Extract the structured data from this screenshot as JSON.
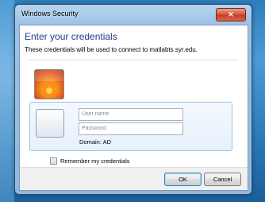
{
  "window": {
    "title": "Windows Security",
    "close_glyph": "×"
  },
  "dialog": {
    "heading": "Enter your credentials",
    "subtext": "These credentials will be used to connect to matlabts.syr.edu.",
    "username_placeholder": "User name",
    "password_placeholder": "Password",
    "domain_label": "Domain: AD",
    "remember_label": "Remember my credentials",
    "ok_label": "OK",
    "cancel_label": "Cancel"
  },
  "icons": {
    "user_tile_top": "flower-user-tile-icon",
    "user_tile_bottom": "blank-user-tile-icon",
    "close": "close-icon"
  },
  "colors": {
    "heading": "#1f3d8a",
    "close_button": "#c23d22",
    "panel_border": "#9cc1e2",
    "desktop": "#2e7fbf"
  }
}
